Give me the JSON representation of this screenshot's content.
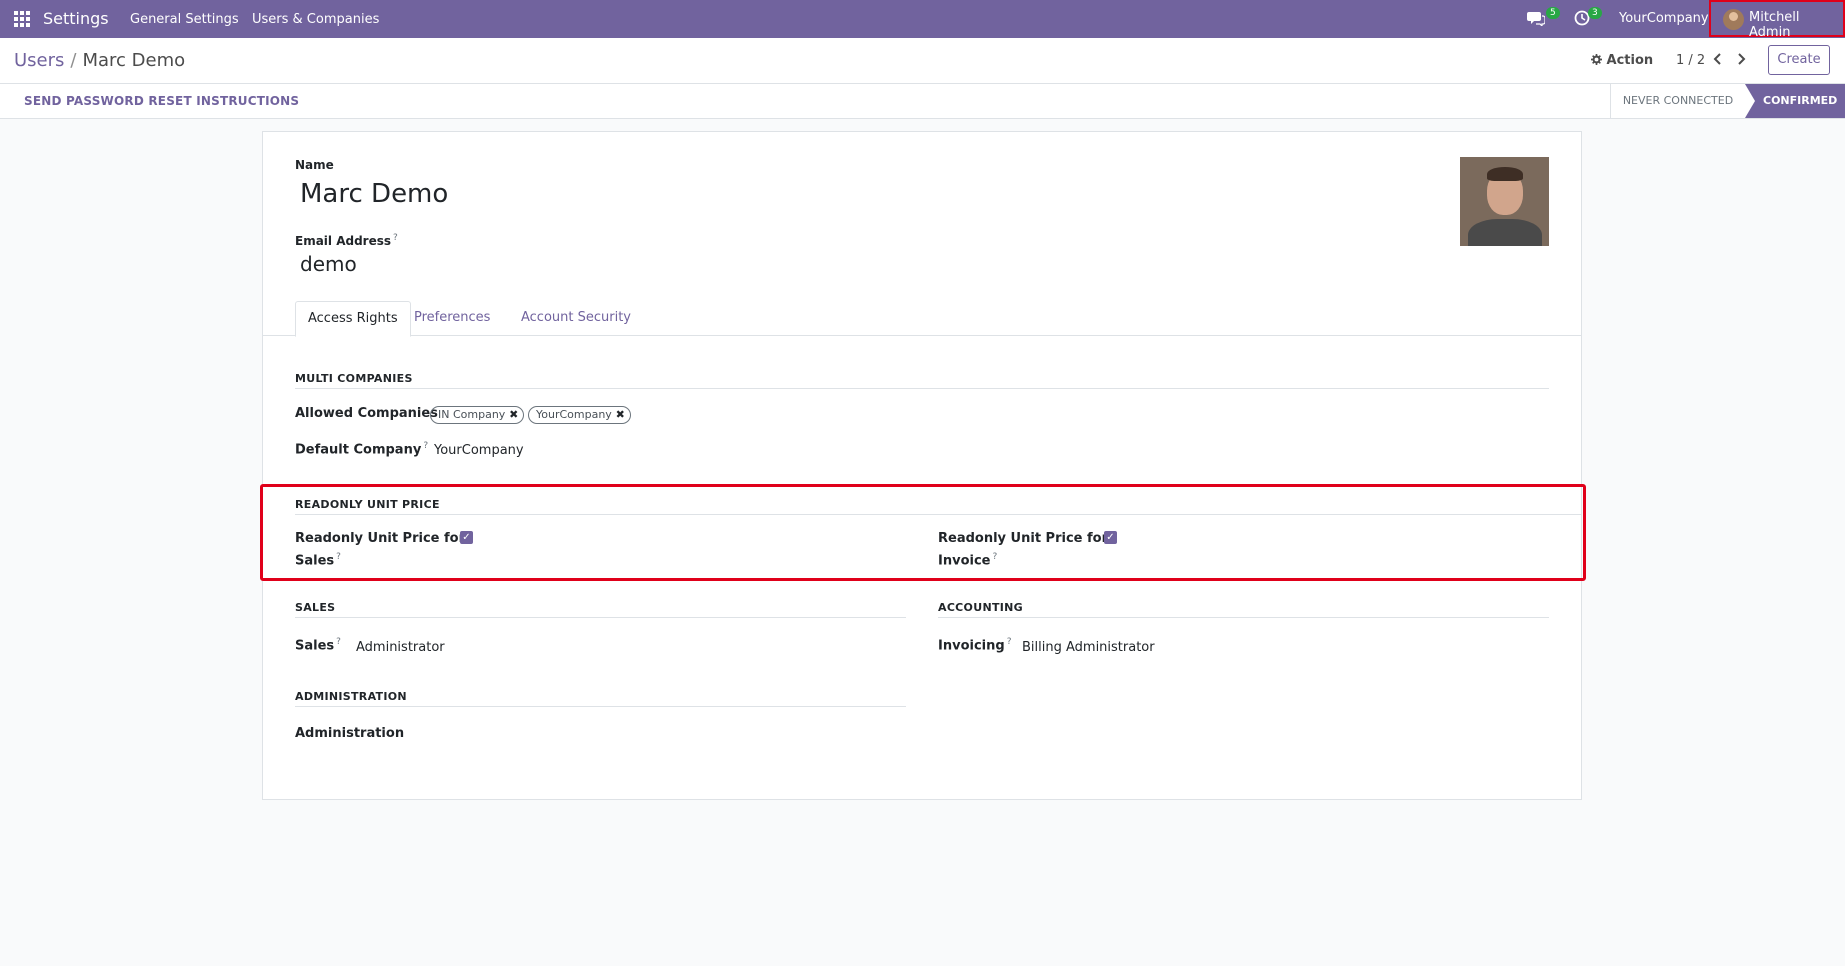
{
  "navbar": {
    "app_name": "Settings",
    "menu": [
      "General Settings",
      "Users & Companies"
    ],
    "messages_count": "5",
    "activities_count": "3",
    "company": "YourCompany",
    "user": "Mitchell Admin"
  },
  "control_panel": {
    "breadcrumb_parent": "Users",
    "breadcrumb_current": "Marc Demo",
    "action_label": "Action",
    "pager": "1 / 2",
    "create_label": "Create"
  },
  "statusbar": {
    "reset_button": "SEND PASSWORD RESET INSTRUCTIONS",
    "stage_never": "NEVER CONNECTED",
    "stage_confirmed": "CONFIRMED"
  },
  "form": {
    "name_label": "Name",
    "name_value": "Marc Demo",
    "email_label": "Email Address",
    "email_value": "demo",
    "tabs": [
      "Access Rights",
      "Preferences",
      "Account Security"
    ],
    "multi_companies_title": "MULTI COMPANIES",
    "allowed_companies_label": "Allowed Companies",
    "allowed_companies": [
      "IN Company",
      "YourCompany"
    ],
    "default_company_label": "Default Company",
    "default_company_value": "YourCompany",
    "readonly_title": "READONLY UNIT PRICE",
    "readonly_sales_label_1": "Readonly Unit Price for",
    "readonly_sales_label_2": "Sales",
    "readonly_invoice_label_1": "Readonly Unit Price for",
    "readonly_invoice_label_2": "Invoice",
    "sales_title": "SALES",
    "sales_label": "Sales",
    "sales_value": "Administrator",
    "accounting_title": "ACCOUNTING",
    "invoicing_label": "Invoicing",
    "invoicing_value": "Billing Administrator",
    "administration_title": "ADMINISTRATION",
    "administration_label": "Administration",
    "help_mark": "?",
    "checked_mark": "✓"
  }
}
